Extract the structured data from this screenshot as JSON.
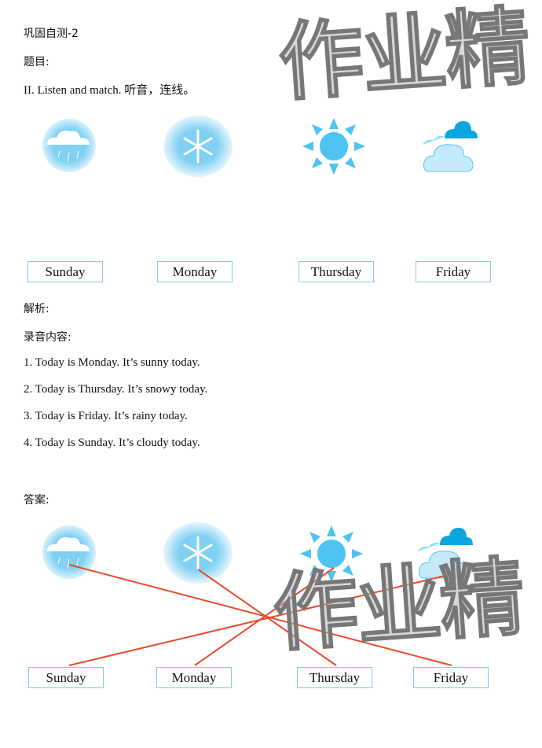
{
  "header": {
    "title": "巩固自测-2",
    "question_label": "题目:",
    "instruction": "II. Listen and match. 听音，连线。"
  },
  "question": {
    "icons": [
      "rain-cloud-icon",
      "snowflake-icon",
      "sun-icon",
      "cloudy-icon"
    ],
    "days": [
      "Sunday",
      "Monday",
      "Thursday",
      "Friday"
    ]
  },
  "analysis": {
    "label": "解析:",
    "recording_label": "录音内容:",
    "lines": [
      "1. Today is Monday. It’s sunny today.",
      "2. Today is Thursday. It’s snowy today.",
      "3. Today is Friday. It’s rainy today.",
      "4. Today is Sunday. It’s cloudy today."
    ]
  },
  "answer": {
    "label": "答案:",
    "days": [
      "Sunday",
      "Monday",
      "Thursday",
      "Friday"
    ],
    "matches": [
      {
        "icon": "rain-cloud-icon",
        "day": "Friday"
      },
      {
        "icon": "snowflake-icon",
        "day": "Thursday"
      },
      {
        "icon": "sun-icon",
        "day": "Monday"
      },
      {
        "icon": "cloudy-icon",
        "day": "Sunday"
      }
    ],
    "line_color": "#e8492a"
  },
  "watermark": "作业精",
  "colors": {
    "icon_blue": "#4cc3f0",
    "box_border": "#7fcbee"
  }
}
